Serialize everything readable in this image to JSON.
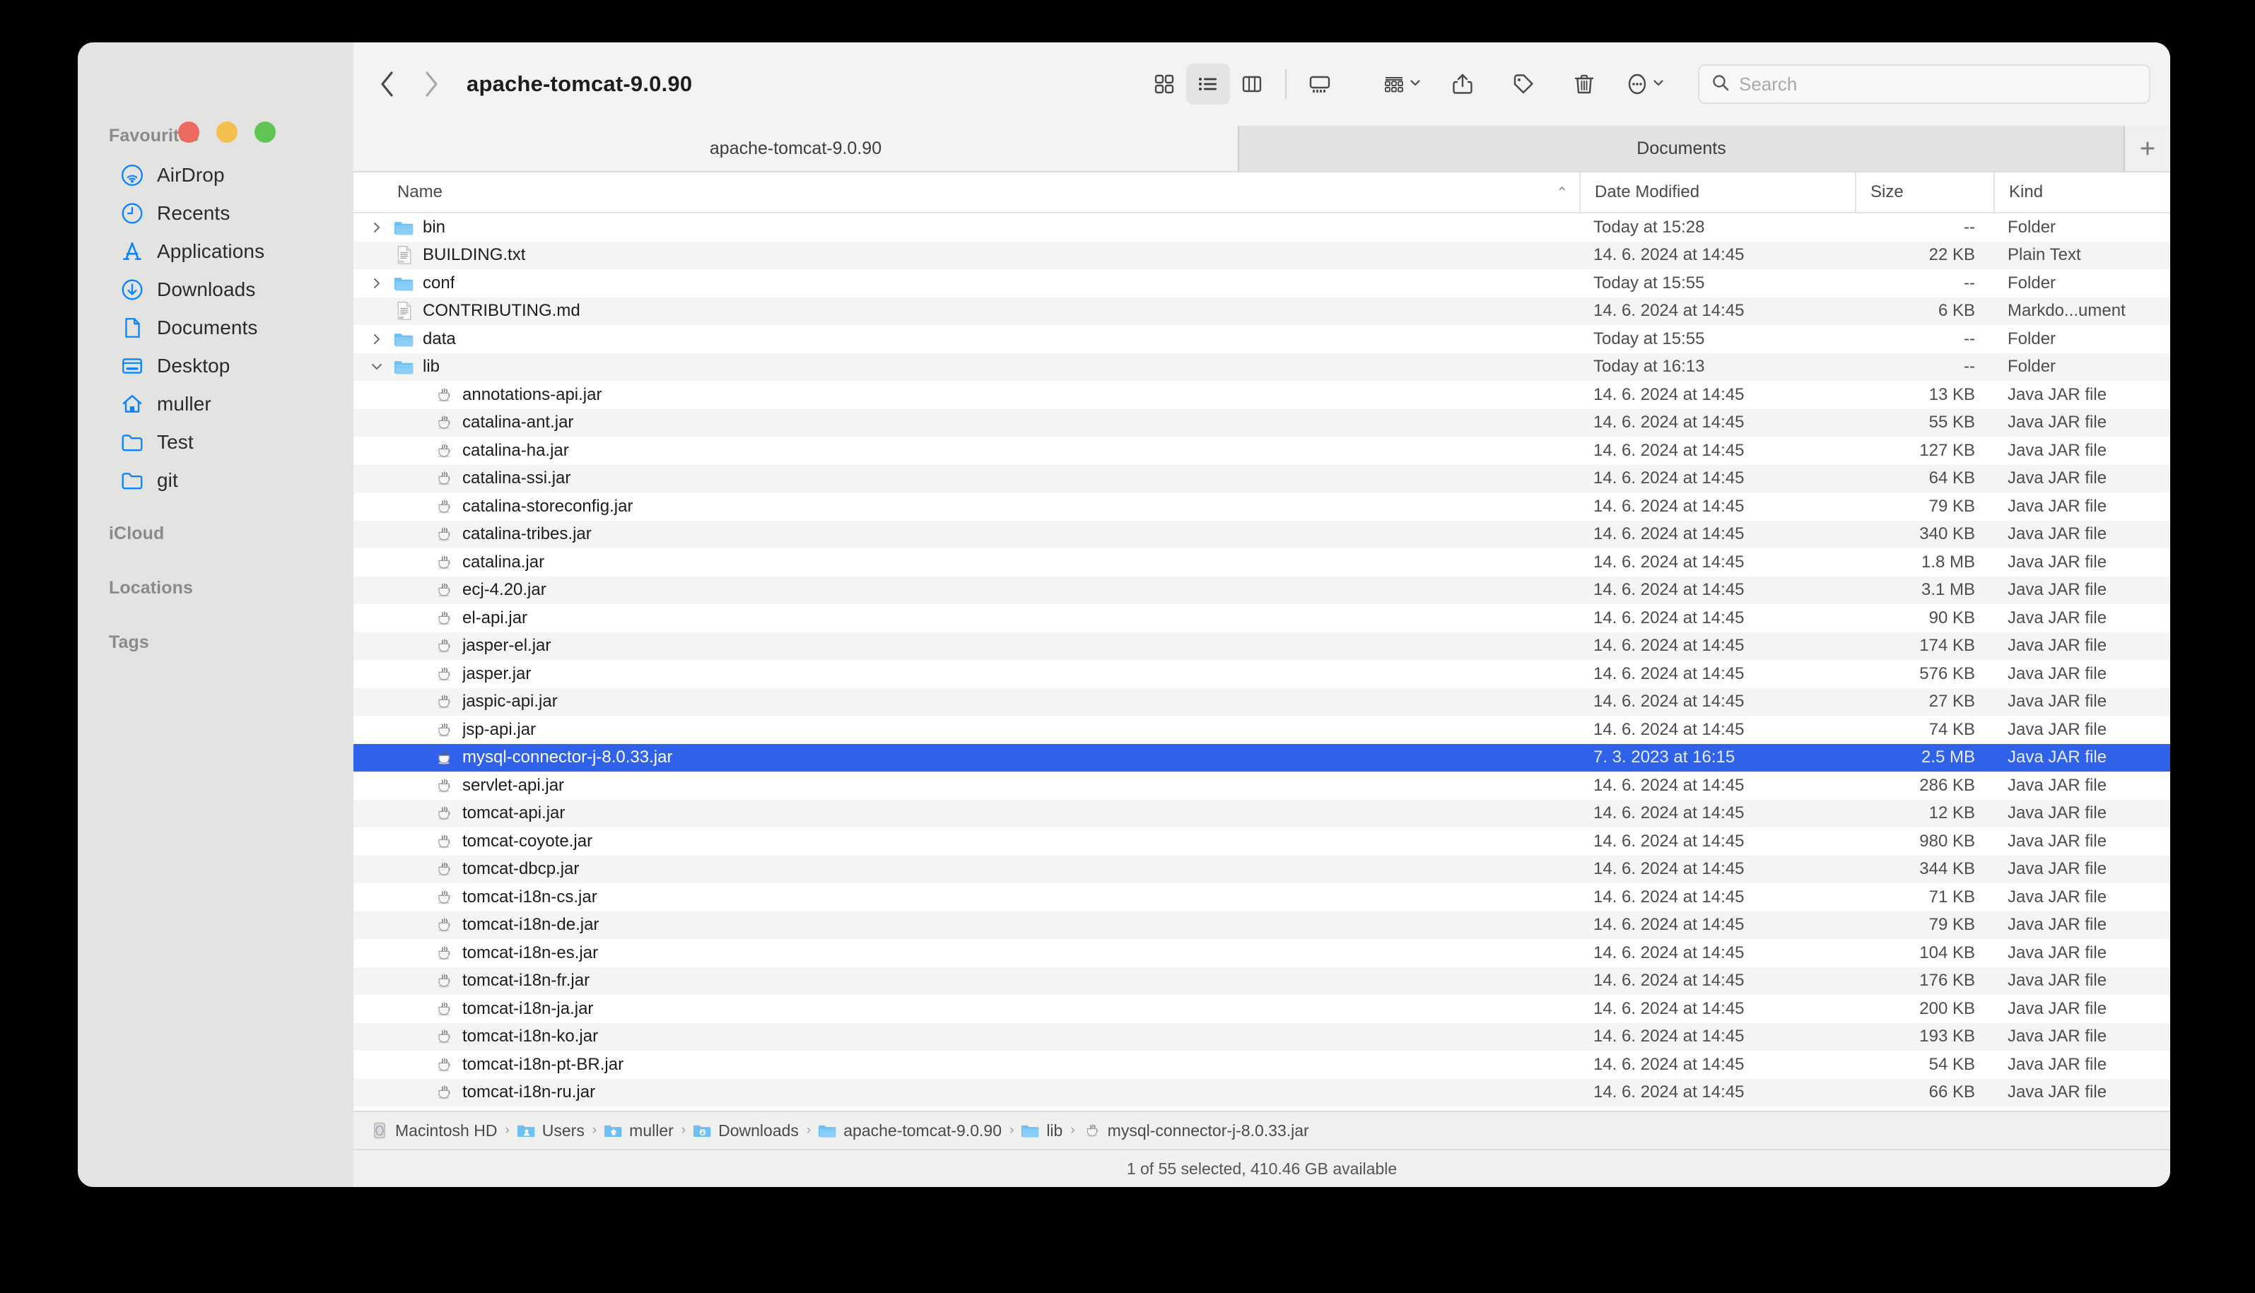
{
  "window": {
    "traffic_lights": [
      "close",
      "minimize",
      "maximize"
    ]
  },
  "toolbar": {
    "back_label": "‹",
    "forward_label": "›",
    "folder_title": "apache-tomcat-9.0.90",
    "view_icon_label": "icon-view",
    "view_list_label": "list-view",
    "view_column_label": "column-view",
    "view_gallery_label": "gallery-view",
    "group_label": "group-by",
    "group_caret": "⌄",
    "share_label": "share",
    "tag_label": "tag",
    "delete_label": "delete",
    "more_label": "more-options",
    "more_caret": "⌄"
  },
  "search": {
    "placeholder": "Search",
    "value": ""
  },
  "tabs": {
    "items": [
      {
        "label": "apache-tomcat-9.0.90",
        "active": true
      },
      {
        "label": "Documents",
        "active": false
      }
    ],
    "new_tab_label": "+"
  },
  "sidebar": {
    "sections": [
      {
        "heading": "Favourites",
        "items": [
          {
            "label": "AirDrop",
            "icon": "airdrop-icon"
          },
          {
            "label": "Recents",
            "icon": "clock-icon"
          },
          {
            "label": "Applications",
            "icon": "applications-icon"
          },
          {
            "label": "Downloads",
            "icon": "downloads-icon"
          },
          {
            "label": "Documents",
            "icon": "document-icon"
          },
          {
            "label": "Desktop",
            "icon": "desktop-icon"
          },
          {
            "label": "muller",
            "icon": "home-icon"
          },
          {
            "label": "Test",
            "icon": "folder-icon"
          },
          {
            "label": "git",
            "icon": "folder-icon"
          }
        ]
      },
      {
        "heading": "iCloud",
        "items": []
      },
      {
        "heading": "Locations",
        "items": []
      },
      {
        "heading": "Tags",
        "items": []
      }
    ]
  },
  "columns": {
    "name": "Name",
    "date_modified": "Date Modified",
    "size": "Size",
    "kind": "Kind",
    "sort_indicator": "⌃"
  },
  "files": [
    {
      "name": "bin",
      "date": "Today at 15:28",
      "size": "--",
      "kind": "Folder",
      "icon": "folder-icon",
      "twisty": "collapsed",
      "depth": 0,
      "selected": false
    },
    {
      "name": "BUILDING.txt",
      "date": "14. 6. 2024 at 14:45",
      "size": "22 KB",
      "kind": "Plain Text",
      "icon": "text-file-icon",
      "twisty": "none",
      "depth": 0,
      "selected": false
    },
    {
      "name": "conf",
      "date": "Today at 15:55",
      "size": "--",
      "kind": "Folder",
      "icon": "folder-icon",
      "twisty": "collapsed",
      "depth": 0,
      "selected": false
    },
    {
      "name": "CONTRIBUTING.md",
      "date": "14. 6. 2024 at 14:45",
      "size": "6 KB",
      "kind": "Markdo...ument",
      "icon": "markdown-file-icon",
      "twisty": "none",
      "depth": 0,
      "selected": false
    },
    {
      "name": "data",
      "date": "Today at 15:55",
      "size": "--",
      "kind": "Folder",
      "icon": "folder-icon",
      "twisty": "collapsed",
      "depth": 0,
      "selected": false
    },
    {
      "name": "lib",
      "date": "Today at 16:13",
      "size": "--",
      "kind": "Folder",
      "icon": "folder-icon",
      "twisty": "expanded",
      "depth": 0,
      "selected": false
    },
    {
      "name": "annotations-api.jar",
      "date": "14. 6. 2024 at 14:45",
      "size": "13 KB",
      "kind": "Java JAR file",
      "icon": "jar-icon",
      "twisty": "none",
      "depth": 1,
      "selected": false
    },
    {
      "name": "catalina-ant.jar",
      "date": "14. 6. 2024 at 14:45",
      "size": "55 KB",
      "kind": "Java JAR file",
      "icon": "jar-icon",
      "twisty": "none",
      "depth": 1,
      "selected": false
    },
    {
      "name": "catalina-ha.jar",
      "date": "14. 6. 2024 at 14:45",
      "size": "127 KB",
      "kind": "Java JAR file",
      "icon": "jar-icon",
      "twisty": "none",
      "depth": 1,
      "selected": false
    },
    {
      "name": "catalina-ssi.jar",
      "date": "14. 6. 2024 at 14:45",
      "size": "64 KB",
      "kind": "Java JAR file",
      "icon": "jar-icon",
      "twisty": "none",
      "depth": 1,
      "selected": false
    },
    {
      "name": "catalina-storeconfig.jar",
      "date": "14. 6. 2024 at 14:45",
      "size": "79 KB",
      "kind": "Java JAR file",
      "icon": "jar-icon",
      "twisty": "none",
      "depth": 1,
      "selected": false
    },
    {
      "name": "catalina-tribes.jar",
      "date": "14. 6. 2024 at 14:45",
      "size": "340 KB",
      "kind": "Java JAR file",
      "icon": "jar-icon",
      "twisty": "none",
      "depth": 1,
      "selected": false
    },
    {
      "name": "catalina.jar",
      "date": "14. 6. 2024 at 14:45",
      "size": "1.8 MB",
      "kind": "Java JAR file",
      "icon": "jar-icon",
      "twisty": "none",
      "depth": 1,
      "selected": false
    },
    {
      "name": "ecj-4.20.jar",
      "date": "14. 6. 2024 at 14:45",
      "size": "3.1 MB",
      "kind": "Java JAR file",
      "icon": "jar-icon",
      "twisty": "none",
      "depth": 1,
      "selected": false
    },
    {
      "name": "el-api.jar",
      "date": "14. 6. 2024 at 14:45",
      "size": "90 KB",
      "kind": "Java JAR file",
      "icon": "jar-icon",
      "twisty": "none",
      "depth": 1,
      "selected": false
    },
    {
      "name": "jasper-el.jar",
      "date": "14. 6. 2024 at 14:45",
      "size": "174 KB",
      "kind": "Java JAR file",
      "icon": "jar-icon",
      "twisty": "none",
      "depth": 1,
      "selected": false
    },
    {
      "name": "jasper.jar",
      "date": "14. 6. 2024 at 14:45",
      "size": "576 KB",
      "kind": "Java JAR file",
      "icon": "jar-icon",
      "twisty": "none",
      "depth": 1,
      "selected": false
    },
    {
      "name": "jaspic-api.jar",
      "date": "14. 6. 2024 at 14:45",
      "size": "27 KB",
      "kind": "Java JAR file",
      "icon": "jar-icon",
      "twisty": "none",
      "depth": 1,
      "selected": false
    },
    {
      "name": "jsp-api.jar",
      "date": "14. 6. 2024 at 14:45",
      "size": "74 KB",
      "kind": "Java JAR file",
      "icon": "jar-icon",
      "twisty": "none",
      "depth": 1,
      "selected": false
    },
    {
      "name": "mysql-connector-j-8.0.33.jar",
      "date": "7. 3. 2023 at 16:15",
      "size": "2.5 MB",
      "kind": "Java JAR file",
      "icon": "jar-icon",
      "twisty": "none",
      "depth": 1,
      "selected": true
    },
    {
      "name": "servlet-api.jar",
      "date": "14. 6. 2024 at 14:45",
      "size": "286 KB",
      "kind": "Java JAR file",
      "icon": "jar-icon",
      "twisty": "none",
      "depth": 1,
      "selected": false
    },
    {
      "name": "tomcat-api.jar",
      "date": "14. 6. 2024 at 14:45",
      "size": "12 KB",
      "kind": "Java JAR file",
      "icon": "jar-icon",
      "twisty": "none",
      "depth": 1,
      "selected": false
    },
    {
      "name": "tomcat-coyote.jar",
      "date": "14. 6. 2024 at 14:45",
      "size": "980 KB",
      "kind": "Java JAR file",
      "icon": "jar-icon",
      "twisty": "none",
      "depth": 1,
      "selected": false
    },
    {
      "name": "tomcat-dbcp.jar",
      "date": "14. 6. 2024 at 14:45",
      "size": "344 KB",
      "kind": "Java JAR file",
      "icon": "jar-icon",
      "twisty": "none",
      "depth": 1,
      "selected": false
    },
    {
      "name": "tomcat-i18n-cs.jar",
      "date": "14. 6. 2024 at 14:45",
      "size": "71 KB",
      "kind": "Java JAR file",
      "icon": "jar-icon",
      "twisty": "none",
      "depth": 1,
      "selected": false
    },
    {
      "name": "tomcat-i18n-de.jar",
      "date": "14. 6. 2024 at 14:45",
      "size": "79 KB",
      "kind": "Java JAR file",
      "icon": "jar-icon",
      "twisty": "none",
      "depth": 1,
      "selected": false
    },
    {
      "name": "tomcat-i18n-es.jar",
      "date": "14. 6. 2024 at 14:45",
      "size": "104 KB",
      "kind": "Java JAR file",
      "icon": "jar-icon",
      "twisty": "none",
      "depth": 1,
      "selected": false
    },
    {
      "name": "tomcat-i18n-fr.jar",
      "date": "14. 6. 2024 at 14:45",
      "size": "176 KB",
      "kind": "Java JAR file",
      "icon": "jar-icon",
      "twisty": "none",
      "depth": 1,
      "selected": false
    },
    {
      "name": "tomcat-i18n-ja.jar",
      "date": "14. 6. 2024 at 14:45",
      "size": "200 KB",
      "kind": "Java JAR file",
      "icon": "jar-icon",
      "twisty": "none",
      "depth": 1,
      "selected": false
    },
    {
      "name": "tomcat-i18n-ko.jar",
      "date": "14. 6. 2024 at 14:45",
      "size": "193 KB",
      "kind": "Java JAR file",
      "icon": "jar-icon",
      "twisty": "none",
      "depth": 1,
      "selected": false
    },
    {
      "name": "tomcat-i18n-pt-BR.jar",
      "date": "14. 6. 2024 at 14:45",
      "size": "54 KB",
      "kind": "Java JAR file",
      "icon": "jar-icon",
      "twisty": "none",
      "depth": 1,
      "selected": false
    },
    {
      "name": "tomcat-i18n-ru.jar",
      "date": "14. 6. 2024 at 14:45",
      "size": "66 KB",
      "kind": "Java JAR file",
      "icon": "jar-icon",
      "twisty": "none",
      "depth": 1,
      "selected": false
    }
  ],
  "pathbar": {
    "crumbs": [
      {
        "label": "Macintosh HD",
        "icon": "harddisk-icon"
      },
      {
        "label": "Users",
        "icon": "users-folder-icon"
      },
      {
        "label": "muller",
        "icon": "home-folder-icon"
      },
      {
        "label": "Downloads",
        "icon": "downloads-folder-icon"
      },
      {
        "label": "apache-tomcat-9.0.90",
        "icon": "folder-icon"
      },
      {
        "label": "lib",
        "icon": "folder-icon"
      },
      {
        "label": "mysql-connector-j-8.0.33.jar",
        "icon": "jar-icon"
      }
    ],
    "separator": "›"
  },
  "statusbar": {
    "text": "1 of 55 selected, 410.46 GB available"
  },
  "colors": {
    "selection_blue": "#2f62e8",
    "accent_blue": "#0a84ff",
    "sidebar_bg": "#e3e3e1",
    "toolbar_bg": "#f3f3f1",
    "row_alt_bg": "#f4f4f2"
  }
}
